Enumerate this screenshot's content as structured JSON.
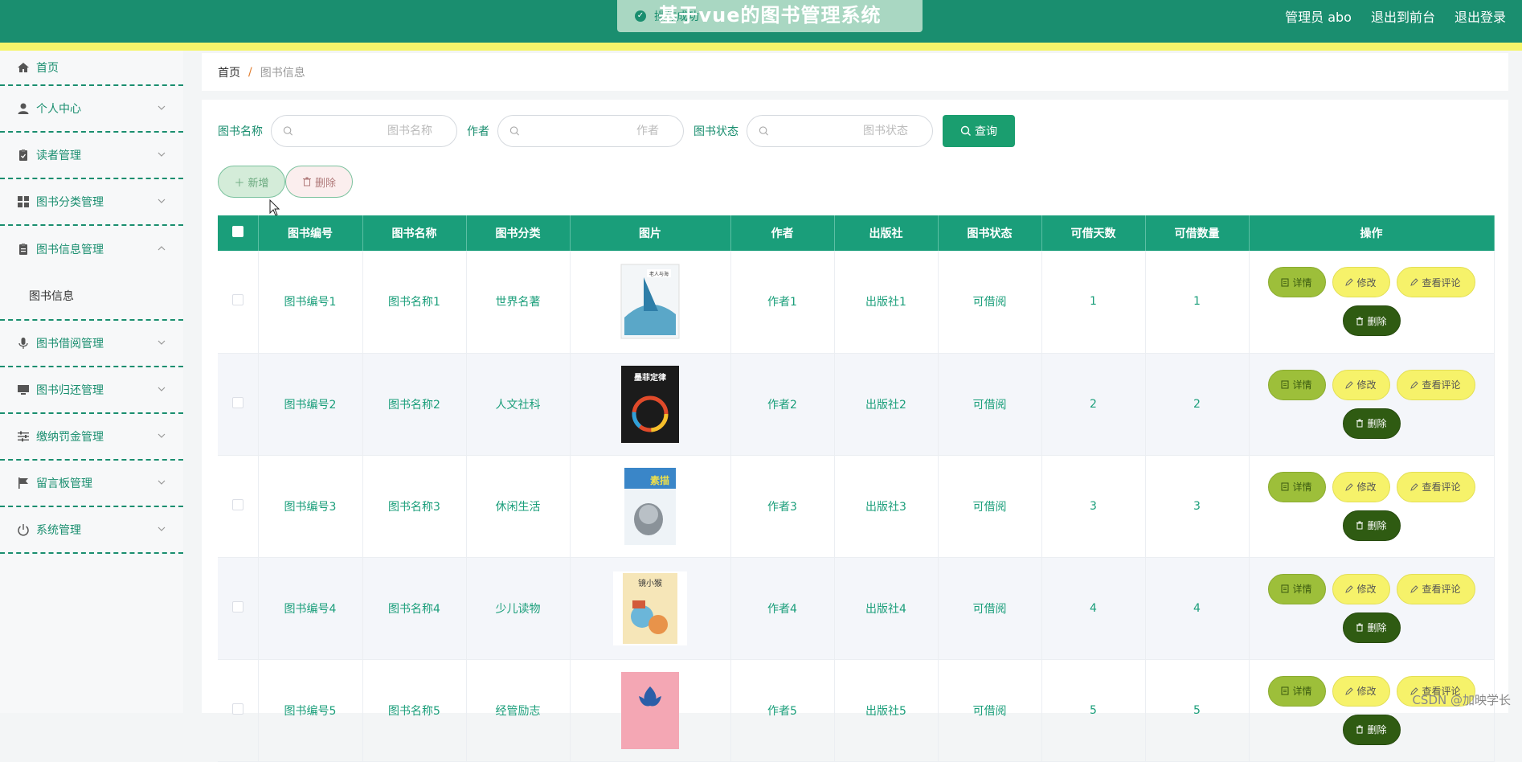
{
  "header": {
    "title": "基于vue的图书管理系统",
    "toast_text": "操作成功",
    "admin": "管理员 abo",
    "front_link": "退出到前台",
    "logout": "退出登录"
  },
  "sidebar": {
    "items": [
      {
        "label": "首页",
        "icon": "home-icon"
      },
      {
        "label": "个人中心",
        "icon": "user-icon"
      },
      {
        "label": "读者管理",
        "icon": "clipboard-icon"
      },
      {
        "label": "图书分类管理",
        "icon": "grid-icon"
      },
      {
        "label": "图书信息管理",
        "icon": "document-icon"
      },
      {
        "label": "图书借阅管理",
        "icon": "microphone-icon"
      },
      {
        "label": "图书归还管理",
        "icon": "monitor-icon"
      },
      {
        "label": "缴纳罚金管理",
        "icon": "sliders-icon"
      },
      {
        "label": "留言板管理",
        "icon": "flag-icon"
      },
      {
        "label": "系统管理",
        "icon": "power-icon"
      }
    ],
    "sub_item": "图书信息"
  },
  "breadcrumb": {
    "home": "首页",
    "sep": "/",
    "current": "图书信息"
  },
  "search": {
    "name_label": "图书名称",
    "name_placeholder": "图书名称",
    "author_label": "作者",
    "author_placeholder": "作者",
    "status_label": "图书状态",
    "status_placeholder": "图书状态",
    "button": "查询"
  },
  "actions": {
    "add": "新增",
    "delete": "删除"
  },
  "table": {
    "headers": [
      "图书编号",
      "图书名称",
      "图书分类",
      "图片",
      "作者",
      "出版社",
      "图书状态",
      "可借天数",
      "可借数量",
      "操作"
    ],
    "rows": [
      {
        "id": "图书编号1",
        "name": "图书名称1",
        "category": "世界名著",
        "author": "作者1",
        "publisher": "出版社1",
        "status": "可借阅",
        "days": "1",
        "qty": "1"
      },
      {
        "id": "图书编号2",
        "name": "图书名称2",
        "category": "人文社科",
        "author": "作者2",
        "publisher": "出版社2",
        "status": "可借阅",
        "days": "2",
        "qty": "2"
      },
      {
        "id": "图书编号3",
        "name": "图书名称3",
        "category": "休闲生活",
        "author": "作者3",
        "publisher": "出版社3",
        "status": "可借阅",
        "days": "3",
        "qty": "3"
      },
      {
        "id": "图书编号4",
        "name": "图书名称4",
        "category": "少儿读物",
        "author": "作者4",
        "publisher": "出版社4",
        "status": "可借阅",
        "days": "4",
        "qty": "4"
      },
      {
        "id": "图书编号5",
        "name": "图书名称5",
        "category": "经管励志",
        "author": "作者5",
        "publisher": "出版社5",
        "status": "可借阅",
        "days": "5",
        "qty": "5"
      }
    ],
    "ops": {
      "detail": "详情",
      "edit": "修改",
      "review": "查看评论",
      "delete": "删除"
    },
    "book_titles": [
      "老人与海",
      "墨菲定律",
      "素描",
      "镜小猴",
      ""
    ]
  },
  "watermark": "CSDN @加映学长",
  "colors": {
    "primary": "#1a8e6f",
    "stripe": "#f5f56a",
    "detail_btn": "#9dbf3a",
    "edit_btn": "#f6f26a",
    "delete_btn": "#2f5b12"
  }
}
